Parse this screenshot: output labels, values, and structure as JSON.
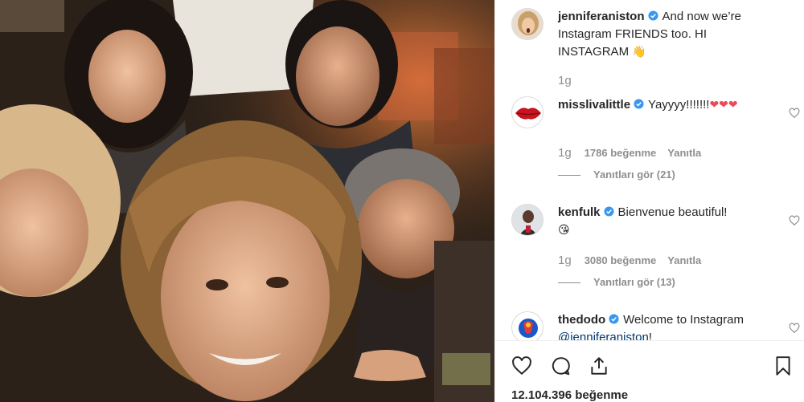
{
  "post": {
    "author": "jenniferaniston",
    "caption": "And now we’re Instagram FRIENDS too. HI INSTAGRAM",
    "caption_emoji": "👋",
    "time": "1g"
  },
  "comments": [
    {
      "username": "misslivalittle",
      "text": "Yayyyy!!!!!!!",
      "emoji": "❤❤❤",
      "time": "1g",
      "likes": "1786 beğenme",
      "reply": "Yanıtla",
      "view_replies": "Yanıtları gör (21)"
    },
    {
      "username": "kenfulk",
      "text": "Bienvenue beautiful!",
      "emoji": "😘",
      "time": "1g",
      "likes": "3080 beğenme",
      "reply": "Yanıtla",
      "view_replies": "Yanıtları gör (13)"
    },
    {
      "username": "thedodo",
      "text": "Welcome to Instagram",
      "mention": "@jenniferaniston",
      "tail": "!"
    }
  ],
  "footer": {
    "likes": "12.104.396 beğenme"
  },
  "icons": {
    "like": "heart-icon",
    "comment": "comment-icon",
    "share": "share-icon",
    "save": "bookmark-icon",
    "verified": "verified-badge-icon"
  },
  "colors": {
    "verified": "#3897f0",
    "heart_red": "#ed4956",
    "meta_gray": "#8e8e8e"
  }
}
